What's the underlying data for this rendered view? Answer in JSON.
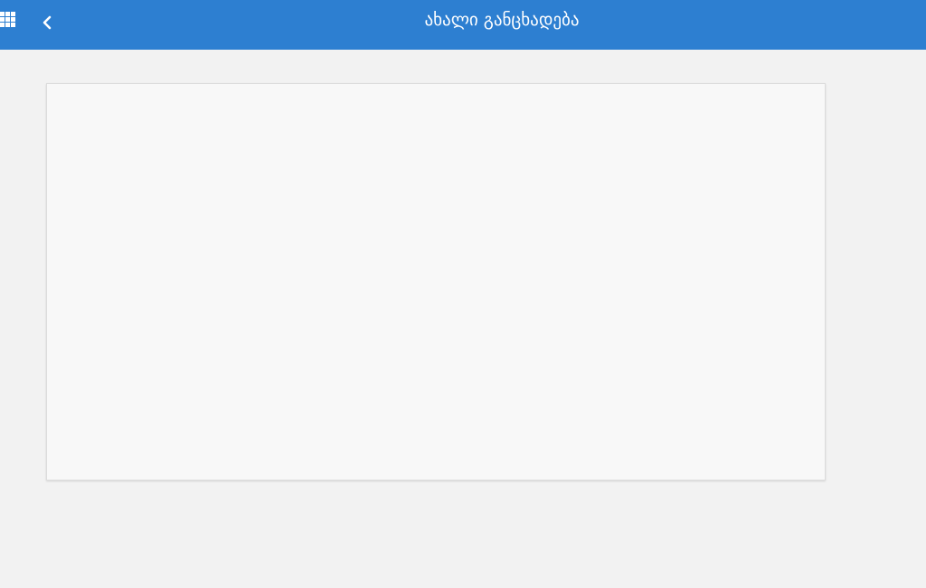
{
  "header": {
    "title": "ახალი განცხადება",
    "background_color": "#2d7fd1",
    "apps_icon": "grid-icon",
    "back_icon": "chevron-left-icon"
  },
  "page": {
    "background_color": "#f2f2f2"
  }
}
